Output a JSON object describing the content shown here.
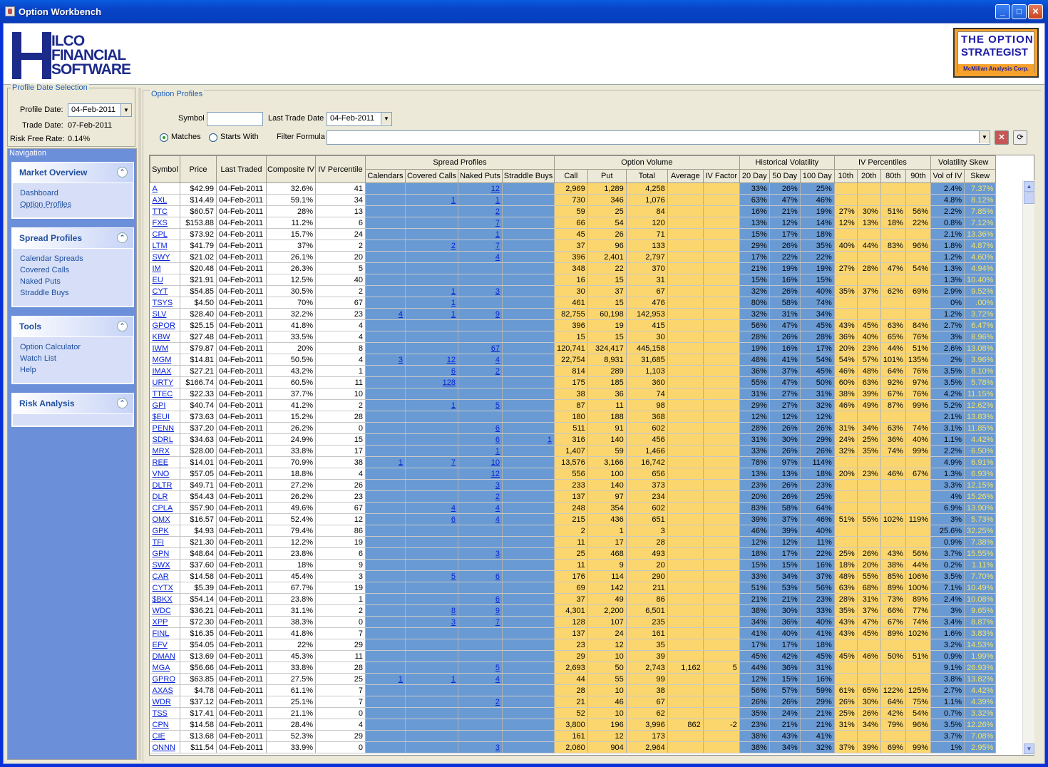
{
  "window": {
    "title": "Option Workbench"
  },
  "logos": {
    "hilco": [
      "ILCO",
      "FINANCIAL",
      "SOFTWARE"
    ],
    "strategist": [
      "THE  OPTION",
      "STRATEGIST",
      "McMillan Analysis Corp."
    ]
  },
  "profile_date": {
    "legend": "Profile Date Selection",
    "profile_label": "Profile Date:",
    "profile_value": "04-Feb-2011",
    "trade_label": "Trade Date:",
    "trade_value": "07-Feb-2011",
    "rate_label": "Risk Free Rate:",
    "rate_value": "0.14%"
  },
  "navigation": {
    "legend": "Navigation",
    "panels": [
      {
        "title": "Market Overview",
        "items": [
          "Dashboard",
          "Option Profiles"
        ]
      },
      {
        "title": "Spread Profiles",
        "items": [
          "Calendar Spreads",
          "Covered Calls",
          "Naked Puts",
          "Straddle Buys"
        ]
      },
      {
        "title": "Tools",
        "items": [
          "Option Calculator",
          "Watch List",
          "Help"
        ]
      },
      {
        "title": "Risk Analysis",
        "items": []
      }
    ]
  },
  "option_profiles": {
    "legend": "Option Profiles",
    "symbol_label": "Symbol",
    "symbol_value": "",
    "last_trade_label": "Last Trade Date",
    "last_trade_value": "04-Feb-2011",
    "matches_label": "Matches",
    "starts_label": "Starts With",
    "filter_label": "Filter Formula",
    "filter_value": ""
  },
  "table": {
    "groups": [
      "Spread Profiles",
      "Option Volume",
      "Historical Volatility",
      "IV Percentiles",
      "Volatility Skew"
    ],
    "top_headers": [
      "Symbol",
      "Price",
      "Last Traded",
      "Composite IV",
      "IV Percentile"
    ],
    "sub_headers": [
      "Calendars",
      "Covered Calls",
      "Naked Puts",
      "Straddle Buys",
      "Call",
      "Put",
      "Total",
      "Average",
      "IV Factor",
      "20 Day",
      "50 Day",
      "100 Day",
      "10th",
      "20th",
      "80th",
      "90th",
      "Vol of IV",
      "Skew"
    ],
    "rows": [
      [
        "A",
        "$42.99",
        "04-Feb-2011",
        "32.6%",
        "41",
        "",
        "",
        "12",
        "",
        "2,969",
        "1,289",
        "4,258",
        "",
        "",
        "33%",
        "26%",
        "25%",
        "",
        "",
        "",
        "",
        "2.4%",
        "7.37%"
      ],
      [
        "AXL",
        "$14.49",
        "04-Feb-2011",
        "59.1%",
        "34",
        "",
        "1",
        "1",
        "",
        "730",
        "346",
        "1,076",
        "",
        "",
        "63%",
        "47%",
        "46%",
        "",
        "",
        "",
        "",
        "4.8%",
        "8.12%"
      ],
      [
        "TTC",
        "$60.57",
        "04-Feb-2011",
        "28%",
        "13",
        "",
        "",
        "2",
        "",
        "59",
        "25",
        "84",
        "",
        "",
        "16%",
        "21%",
        "19%",
        "27%",
        "30%",
        "51%",
        "56%",
        "2.2%",
        "7.85%"
      ],
      [
        "FXS",
        "$153.88",
        "04-Feb-2011",
        "11.2%",
        "6",
        "",
        "",
        "7",
        "",
        "66",
        "54",
        "120",
        "",
        "",
        "13%",
        "12%",
        "14%",
        "12%",
        "13%",
        "18%",
        "22%",
        "0.8%",
        "7.12%"
      ],
      [
        "CPL",
        "$73.92",
        "04-Feb-2011",
        "15.7%",
        "24",
        "",
        "",
        "1",
        "",
        "45",
        "26",
        "71",
        "",
        "",
        "15%",
        "17%",
        "18%",
        "",
        "",
        "",
        "",
        "2.1%",
        "13.36%"
      ],
      [
        "LTM",
        "$41.79",
        "04-Feb-2011",
        "37%",
        "2",
        "",
        "2",
        "7",
        "",
        "37",
        "96",
        "133",
        "",
        "",
        "29%",
        "26%",
        "35%",
        "40%",
        "44%",
        "83%",
        "96%",
        "1.8%",
        "4.87%"
      ],
      [
        "SWY",
        "$21.02",
        "04-Feb-2011",
        "26.1%",
        "20",
        "",
        "",
        "4",
        "",
        "396",
        "2,401",
        "2,797",
        "",
        "",
        "17%",
        "22%",
        "22%",
        "",
        "",
        "",
        "",
        "1.2%",
        "4.60%"
      ],
      [
        "IM",
        "$20.48",
        "04-Feb-2011",
        "26.3%",
        "5",
        "",
        "",
        "",
        "",
        "348",
        "22",
        "370",
        "",
        "",
        "21%",
        "19%",
        "19%",
        "27%",
        "28%",
        "47%",
        "54%",
        "1.3%",
        "4.94%"
      ],
      [
        "EU",
        "$21.91",
        "04-Feb-2011",
        "12.5%",
        "40",
        "",
        "",
        "",
        "",
        "16",
        "15",
        "31",
        "",
        "",
        "15%",
        "16%",
        "15%",
        "",
        "",
        "",
        "",
        "1.3%",
        "10.40%"
      ],
      [
        "CYT",
        "$54.85",
        "04-Feb-2011",
        "30.5%",
        "2",
        "",
        "1",
        "3",
        "",
        "30",
        "37",
        "67",
        "",
        "",
        "32%",
        "26%",
        "40%",
        "35%",
        "37%",
        "62%",
        "69%",
        "2.9%",
        "9.52%"
      ],
      [
        "TSYS",
        "$4.50",
        "04-Feb-2011",
        "70%",
        "67",
        "",
        "1",
        "",
        "",
        "461",
        "15",
        "476",
        "",
        "",
        "80%",
        "58%",
        "74%",
        "",
        "",
        "",
        "",
        "0%",
        ".00%"
      ],
      [
        "SLV",
        "$28.40",
        "04-Feb-2011",
        "32.2%",
        "23",
        "4",
        "1",
        "9",
        "",
        "82,755",
        "60,198",
        "142,953",
        "",
        "",
        "32%",
        "31%",
        "34%",
        "",
        "",
        "",
        "",
        "1.2%",
        "3.72%"
      ],
      [
        "GPOR",
        "$25.15",
        "04-Feb-2011",
        "41.8%",
        "4",
        "",
        "",
        "",
        "",
        "396",
        "19",
        "415",
        "",
        "",
        "56%",
        "47%",
        "45%",
        "43%",
        "45%",
        "63%",
        "84%",
        "2.7%",
        "6.47%"
      ],
      [
        "KBW",
        "$27.48",
        "04-Feb-2011",
        "33.5%",
        "4",
        "",
        "",
        "",
        "",
        "15",
        "15",
        "30",
        "",
        "",
        "28%",
        "26%",
        "28%",
        "36%",
        "40%",
        "65%",
        "76%",
        "3%",
        "8.96%"
      ],
      [
        "IWM",
        "$79.87",
        "04-Feb-2011",
        "20%",
        "8",
        "",
        "",
        "67",
        "",
        "120,741",
        "324,417",
        "445,158",
        "",
        "",
        "19%",
        "16%",
        "17%",
        "20%",
        "23%",
        "44%",
        "51%",
        "2.6%",
        "13.08%"
      ],
      [
        "MGM",
        "$14.81",
        "04-Feb-2011",
        "50.5%",
        "4",
        "3",
        "12",
        "4",
        "",
        "22,754",
        "8,931",
        "31,685",
        "",
        "",
        "48%",
        "41%",
        "54%",
        "54%",
        "57%",
        "101%",
        "135%",
        "2%",
        "3.96%"
      ],
      [
        "IMAX",
        "$27.21",
        "04-Feb-2011",
        "43.2%",
        "1",
        "",
        "6",
        "2",
        "",
        "814",
        "289",
        "1,103",
        "",
        "",
        "36%",
        "37%",
        "45%",
        "46%",
        "48%",
        "64%",
        "76%",
        "3.5%",
        "8.10%"
      ],
      [
        "URTY",
        "$166.74",
        "04-Feb-2011",
        "60.5%",
        "11",
        "",
        "128",
        "",
        "",
        "175",
        "185",
        "360",
        "",
        "",
        "55%",
        "47%",
        "50%",
        "60%",
        "63%",
        "92%",
        "97%",
        "3.5%",
        "5.78%"
      ],
      [
        "TTEC",
        "$22.33",
        "04-Feb-2011",
        "37.7%",
        "10",
        "",
        "",
        "",
        "",
        "38",
        "36",
        "74",
        "",
        "",
        "31%",
        "27%",
        "31%",
        "38%",
        "39%",
        "67%",
        "76%",
        "4.2%",
        "11.15%"
      ],
      [
        "GPI",
        "$40.74",
        "04-Feb-2011",
        "41.2%",
        "2",
        "",
        "1",
        "5",
        "",
        "87",
        "11",
        "98",
        "",
        "",
        "29%",
        "27%",
        "32%",
        "46%",
        "49%",
        "87%",
        "99%",
        "5.2%",
        "12.62%"
      ],
      [
        "$EUI",
        "$73.63",
        "04-Feb-2011",
        "15.2%",
        "28",
        "",
        "",
        "",
        "",
        "180",
        "188",
        "368",
        "",
        "",
        "12%",
        "12%",
        "12%",
        "",
        "",
        "",
        "",
        "2.1%",
        "13.83%"
      ],
      [
        "PENN",
        "$37.20",
        "04-Feb-2011",
        "26.2%",
        "0",
        "",
        "",
        "6",
        "",
        "511",
        "91",
        "602",
        "",
        "",
        "28%",
        "26%",
        "26%",
        "31%",
        "34%",
        "63%",
        "74%",
        "3.1%",
        "11.85%"
      ],
      [
        "SDRL",
        "$34.63",
        "04-Feb-2011",
        "24.9%",
        "15",
        "",
        "",
        "6",
        "1",
        "316",
        "140",
        "456",
        "",
        "",
        "31%",
        "30%",
        "29%",
        "24%",
        "25%",
        "36%",
        "40%",
        "1.1%",
        "4.42%"
      ],
      [
        "MRX",
        "$28.00",
        "04-Feb-2011",
        "33.8%",
        "17",
        "",
        "",
        "1",
        "",
        "1,407",
        "59",
        "1,466",
        "",
        "",
        "33%",
        "26%",
        "26%",
        "32%",
        "35%",
        "74%",
        "99%",
        "2.2%",
        "6.50%"
      ],
      [
        "REE",
        "$14.01",
        "04-Feb-2011",
        "70.9%",
        "38",
        "1",
        "7",
        "10",
        "",
        "13,576",
        "3,166",
        "16,742",
        "",
        "",
        "78%",
        "97%",
        "114%",
        "",
        "",
        "",
        "",
        "4.9%",
        "6.91%"
      ],
      [
        "VNO",
        "$57.05",
        "04-Feb-2011",
        "18.8%",
        "4",
        "",
        "",
        "12",
        "",
        "556",
        "100",
        "656",
        "",
        "",
        "13%",
        "13%",
        "18%",
        "20%",
        "23%",
        "46%",
        "67%",
        "1.3%",
        "6.93%"
      ],
      [
        "DLTR",
        "$49.71",
        "04-Feb-2011",
        "27.2%",
        "26",
        "",
        "",
        "3",
        "",
        "233",
        "140",
        "373",
        "",
        "",
        "23%",
        "26%",
        "23%",
        "",
        "",
        "",
        "",
        "3.3%",
        "12.15%"
      ],
      [
        "DLR",
        "$54.43",
        "04-Feb-2011",
        "26.2%",
        "23",
        "",
        "",
        "2",
        "",
        "137",
        "97",
        "234",
        "",
        "",
        "20%",
        "26%",
        "25%",
        "",
        "",
        "",
        "",
        "4%",
        "15.26%"
      ],
      [
        "CPLA",
        "$57.90",
        "04-Feb-2011",
        "49.6%",
        "67",
        "",
        "4",
        "4",
        "",
        "248",
        "354",
        "602",
        "",
        "",
        "83%",
        "58%",
        "64%",
        "",
        "",
        "",
        "",
        "6.9%",
        "13.90%"
      ],
      [
        "OMX",
        "$16.57",
        "04-Feb-2011",
        "52.4%",
        "12",
        "",
        "6",
        "4",
        "",
        "215",
        "436",
        "651",
        "",
        "",
        "39%",
        "37%",
        "46%",
        "51%",
        "55%",
        "102%",
        "119%",
        "3%",
        "5.73%"
      ],
      [
        "GPK",
        "$4.93",
        "04-Feb-2011",
        "79.4%",
        "86",
        "",
        "",
        "",
        "",
        "2",
        "1",
        "3",
        "",
        "",
        "46%",
        "39%",
        "40%",
        "",
        "",
        "",
        "",
        "25.6%",
        "32.25%"
      ],
      [
        "TFI",
        "$21.30",
        "04-Feb-2011",
        "12.2%",
        "19",
        "",
        "",
        "",
        "",
        "11",
        "17",
        "28",
        "",
        "",
        "12%",
        "12%",
        "11%",
        "",
        "",
        "",
        "",
        "0.9%",
        "7.38%"
      ],
      [
        "GPN",
        "$48.64",
        "04-Feb-2011",
        "23.8%",
        "6",
        "",
        "",
        "3",
        "",
        "25",
        "468",
        "493",
        "",
        "",
        "18%",
        "17%",
        "22%",
        "25%",
        "26%",
        "43%",
        "56%",
        "3.7%",
        "15.55%"
      ],
      [
        "SWX",
        "$37.60",
        "04-Feb-2011",
        "18%",
        "9",
        "",
        "",
        "",
        "",
        "11",
        "9",
        "20",
        "",
        "",
        "15%",
        "15%",
        "16%",
        "18%",
        "20%",
        "38%",
        "44%",
        "0.2%",
        "1.11%"
      ],
      [
        "CAR",
        "$14.58",
        "04-Feb-2011",
        "45.4%",
        "3",
        "",
        "5",
        "6",
        "",
        "176",
        "114",
        "290",
        "",
        "",
        "33%",
        "34%",
        "37%",
        "48%",
        "55%",
        "85%",
        "106%",
        "3.5%",
        "7.70%"
      ],
      [
        "CYTX",
        "$5.39",
        "04-Feb-2011",
        "67.7%",
        "19",
        "",
        "",
        "",
        "",
        "69",
        "142",
        "211",
        "",
        "",
        "51%",
        "53%",
        "56%",
        "63%",
        "68%",
        "89%",
        "100%",
        "7.1%",
        "10.49%"
      ],
      [
        "$BKX",
        "$54.14",
        "04-Feb-2011",
        "23.8%",
        "1",
        "",
        "",
        "6",
        "",
        "37",
        "49",
        "86",
        "",
        "",
        "21%",
        "21%",
        "23%",
        "28%",
        "31%",
        "73%",
        "89%",
        "2.4%",
        "10.08%"
      ],
      [
        "WDC",
        "$36.21",
        "04-Feb-2011",
        "31.1%",
        "2",
        "",
        "8",
        "9",
        "",
        "4,301",
        "2,200",
        "6,501",
        "",
        "",
        "38%",
        "30%",
        "33%",
        "35%",
        "37%",
        "66%",
        "77%",
        "3%",
        "9.65%"
      ],
      [
        "XPP",
        "$72.30",
        "04-Feb-2011",
        "38.3%",
        "0",
        "",
        "3",
        "7",
        "",
        "128",
        "107",
        "235",
        "",
        "",
        "34%",
        "36%",
        "40%",
        "43%",
        "47%",
        "67%",
        "74%",
        "3.4%",
        "8.87%"
      ],
      [
        "FINL",
        "$16.35",
        "04-Feb-2011",
        "41.8%",
        "7",
        "",
        "",
        "",
        "",
        "137",
        "24",
        "161",
        "",
        "",
        "41%",
        "40%",
        "41%",
        "43%",
        "45%",
        "89%",
        "102%",
        "1.6%",
        "3.83%"
      ],
      [
        "EFV",
        "$54.05",
        "04-Feb-2011",
        "22%",
        "29",
        "",
        "",
        "",
        "",
        "23",
        "12",
        "35",
        "",
        "",
        "17%",
        "17%",
        "18%",
        "",
        "",
        "",
        "",
        "3.2%",
        "14.53%"
      ],
      [
        "DMAN",
        "$13.69",
        "04-Feb-2011",
        "45.3%",
        "11",
        "",
        "",
        "",
        "",
        "29",
        "10",
        "39",
        "",
        "",
        "45%",
        "42%",
        "45%",
        "45%",
        "46%",
        "50%",
        "51%",
        "0.9%",
        "1.99%"
      ],
      [
        "MGA",
        "$56.66",
        "04-Feb-2011",
        "33.8%",
        "28",
        "",
        "",
        "5",
        "",
        "2,693",
        "50",
        "2,743",
        "1,162",
        "5",
        "44%",
        "36%",
        "31%",
        "",
        "",
        "",
        "",
        "9.1%",
        "26.93%"
      ],
      [
        "GPRO",
        "$63.85",
        "04-Feb-2011",
        "27.5%",
        "25",
        "1",
        "1",
        "4",
        "",
        "44",
        "55",
        "99",
        "",
        "",
        "12%",
        "15%",
        "16%",
        "",
        "",
        "",
        "",
        "3.8%",
        "13.82%"
      ],
      [
        "AXAS",
        "$4.78",
        "04-Feb-2011",
        "61.1%",
        "7",
        "",
        "",
        "",
        "",
        "28",
        "10",
        "38",
        "",
        "",
        "56%",
        "57%",
        "59%",
        "61%",
        "65%",
        "122%",
        "125%",
        "2.7%",
        "4.42%"
      ],
      [
        "WDR",
        "$37.12",
        "04-Feb-2011",
        "25.1%",
        "7",
        "",
        "",
        "2",
        "",
        "21",
        "46",
        "67",
        "",
        "",
        "26%",
        "26%",
        "29%",
        "26%",
        "30%",
        "64%",
        "75%",
        "1.1%",
        "4.39%"
      ],
      [
        "TSS",
        "$17.41",
        "04-Feb-2011",
        "21.1%",
        "0",
        "",
        "",
        "",
        "",
        "52",
        "10",
        "62",
        "",
        "",
        "35%",
        "24%",
        "21%",
        "25%",
        "26%",
        "42%",
        "54%",
        "0.7%",
        "3.32%"
      ],
      [
        "CPN",
        "$14.58",
        "04-Feb-2011",
        "28.4%",
        "4",
        "",
        "",
        "",
        "",
        "3,800",
        "196",
        "3,996",
        "862",
        "-2",
        "23%",
        "21%",
        "21%",
        "31%",
        "34%",
        "79%",
        "96%",
        "3.5%",
        "12.26%"
      ],
      [
        "CIE",
        "$13.68",
        "04-Feb-2011",
        "52.3%",
        "29",
        "",
        "",
        "",
        "",
        "161",
        "12",
        "173",
        "",
        "",
        "38%",
        "43%",
        "41%",
        "",
        "",
        "",
        "",
        "3.7%",
        "7.08%"
      ],
      [
        "ONNN",
        "$11.54",
        "04-Feb-2011",
        "33.9%",
        "0",
        "",
        "",
        "3",
        "",
        "2,060",
        "904",
        "2,964",
        "",
        "",
        "38%",
        "34%",
        "32%",
        "37%",
        "39%",
        "69%",
        "99%",
        "1%",
        "2.95%"
      ]
    ]
  }
}
